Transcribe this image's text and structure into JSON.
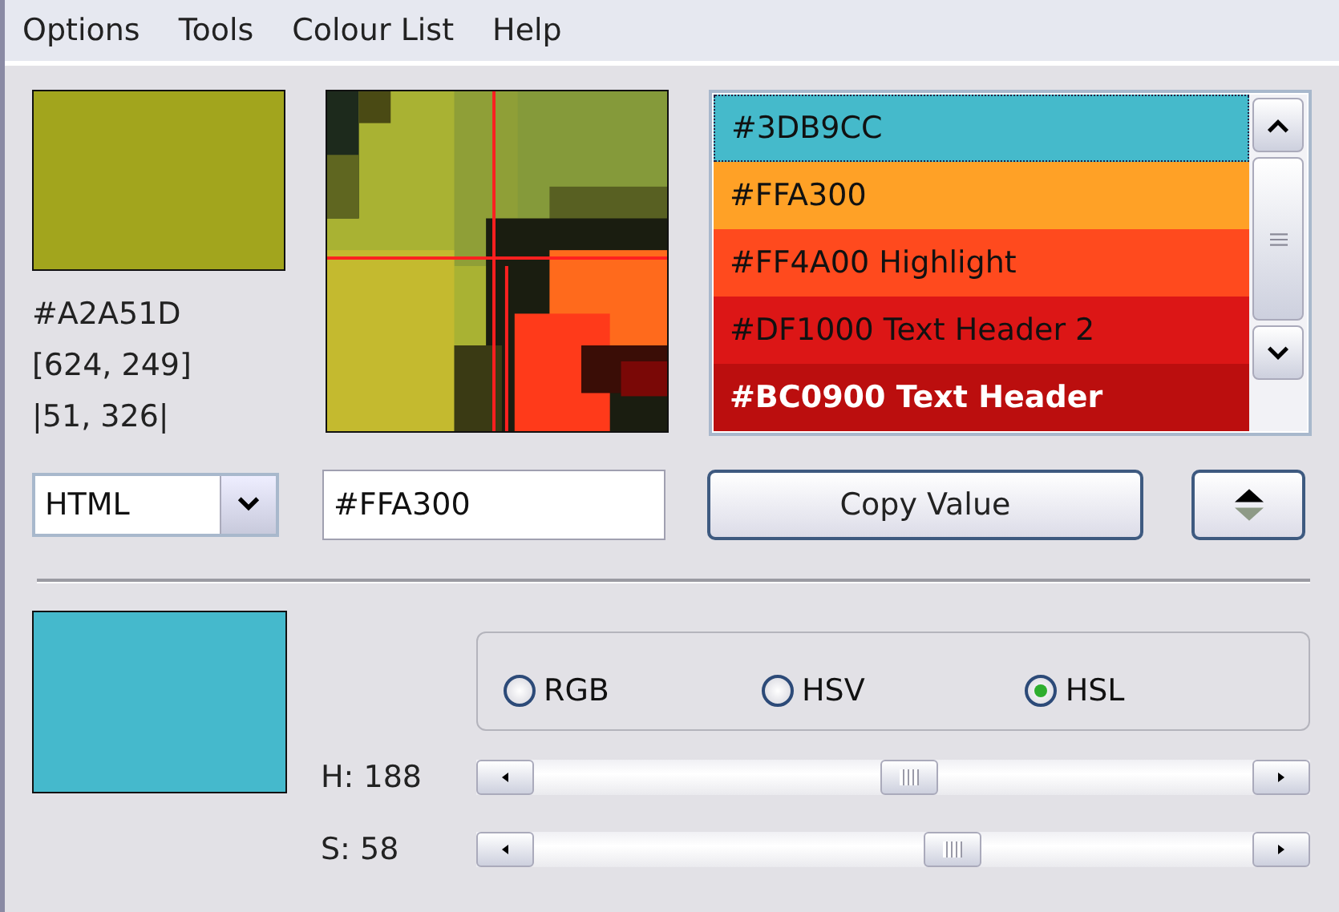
{
  "menu": [
    "Options",
    "Tools",
    "Colour List",
    "Help"
  ],
  "picked": {
    "color": "#a2a51d",
    "hex": "#A2A51D",
    "position": "[624, 249]",
    "offset": "|51, 326|"
  },
  "colour_list": [
    {
      "label": "#3DB9CC",
      "color": "#45bacb",
      "selected": true
    },
    {
      "label": "#FFA300",
      "color": "#ffa126",
      "selected": false
    },
    {
      "label": "#FF4A00 Highlight",
      "color": "#ff4a1e",
      "selected": false
    },
    {
      "label": "#DF1000 Text Header 2",
      "color": "#dc1616",
      "selected": false
    },
    {
      "label": "#BC0900 Text Header",
      "color": "#bb0e0e",
      "selected": false
    }
  ],
  "format": {
    "value": "HTML"
  },
  "value_field": {
    "value": "#FFA300"
  },
  "copy_button": "Copy Value",
  "current": {
    "color": "#45b9cc"
  },
  "modes": [
    {
      "label": "RGB",
      "selected": false
    },
    {
      "label": "HSV",
      "selected": false
    },
    {
      "label": "HSL",
      "selected": true
    }
  ],
  "sliders": [
    {
      "label": "H: 188",
      "level": 0.52
    },
    {
      "label": "S: 58",
      "level": 0.58
    }
  ]
}
